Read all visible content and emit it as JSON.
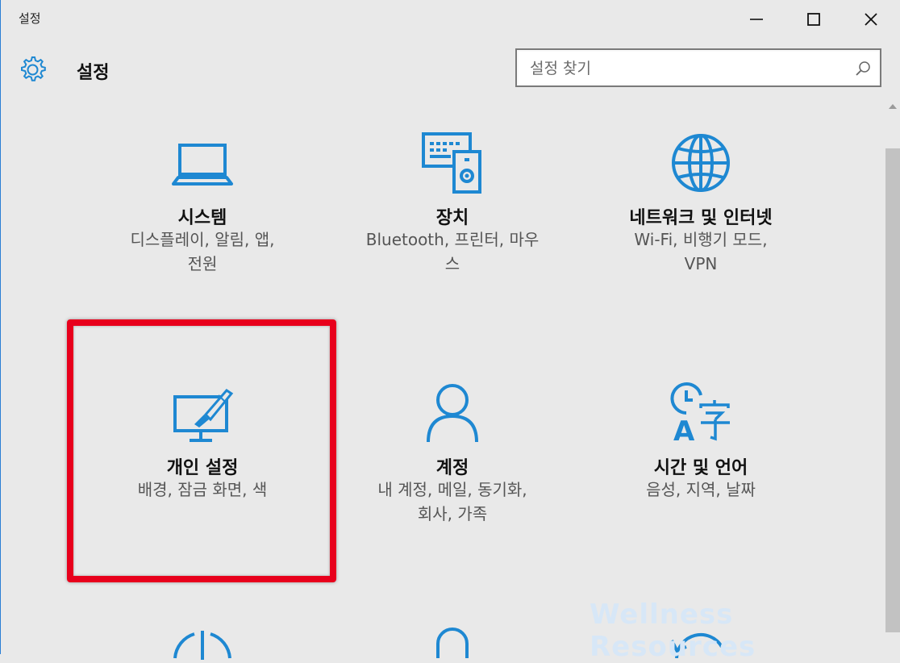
{
  "window": {
    "title": "설정",
    "minimize_icon": "minimize-icon",
    "maximize_icon": "maximize-icon",
    "close_icon": "close-icon"
  },
  "header": {
    "icon": "gear-icon",
    "title": "설정"
  },
  "search": {
    "placeholder": "설정 찾기",
    "value": "",
    "icon": "search-icon"
  },
  "accent_color": "#1e88d2",
  "highlight_color": "#e8001c",
  "tiles": [
    {
      "title": "시스템",
      "desc": [
        "디스플레이, 알림, 앱,",
        "전원"
      ],
      "icon": "laptop-icon"
    },
    {
      "title": "장치",
      "desc": [
        "Bluetooth, 프린터, 마우",
        "스"
      ],
      "icon": "devices-icon"
    },
    {
      "title": "네트워크 및 인터넷",
      "desc": [
        "Wi-Fi, 비행기 모드,",
        "VPN"
      ],
      "icon": "globe-icon"
    },
    {
      "title": "개인 설정",
      "desc": [
        "배경, 잠금 화면, 색"
      ],
      "icon": "personalization-icon"
    },
    {
      "title": "계정",
      "desc": [
        "내 계정, 메일, 동기화,",
        "회사, 가족"
      ],
      "icon": "account-icon"
    },
    {
      "title": "시간 및 언어",
      "desc": [
        "음성, 지역, 날짜"
      ],
      "icon": "time-language-icon"
    }
  ],
  "partial_icons": [
    "ease-of-access-icon",
    "privacy-icon",
    "update-icon"
  ],
  "watermark": "Wellness Resources"
}
